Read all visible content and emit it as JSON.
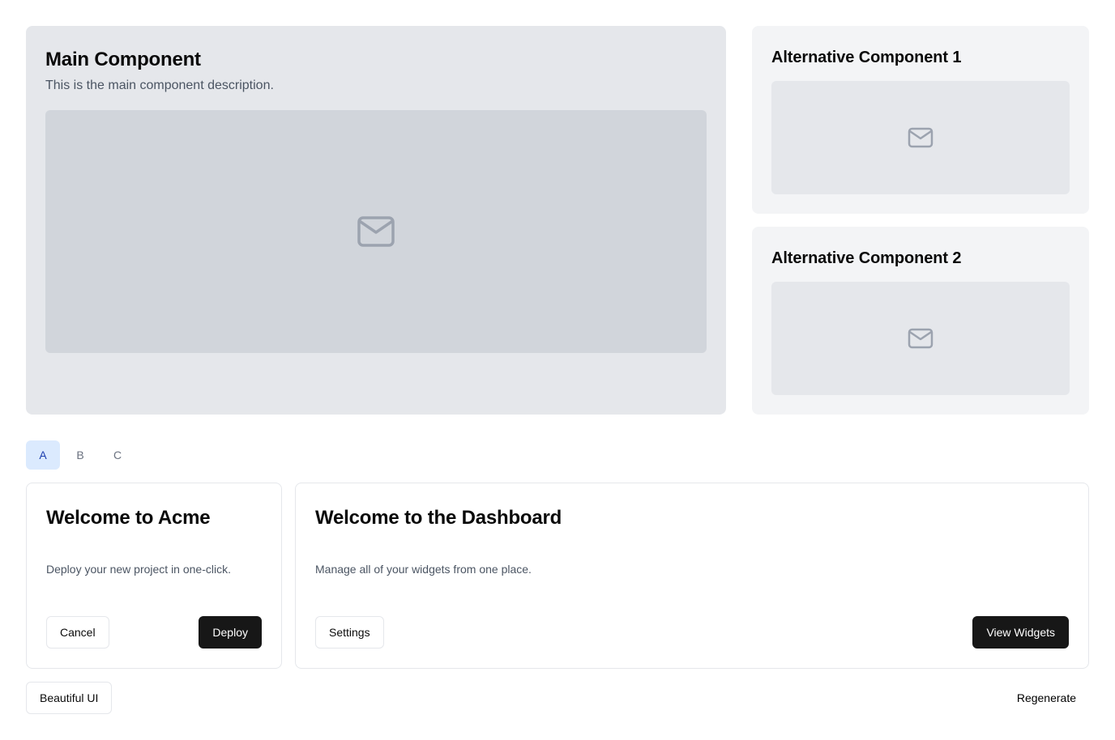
{
  "main": {
    "title": "Main Component",
    "description": "This is the main component description."
  },
  "alternatives": [
    {
      "title": "Alternative Component 1"
    },
    {
      "title": "Alternative Component 2"
    }
  ],
  "tabs": [
    {
      "label": "A",
      "active": true
    },
    {
      "label": "B",
      "active": false
    },
    {
      "label": "C",
      "active": false
    }
  ],
  "cards": {
    "acme": {
      "title": "Welcome to Acme",
      "description": "Deploy your new project in one-click.",
      "secondary_label": "Cancel",
      "primary_label": "Deploy"
    },
    "dashboard": {
      "title": "Welcome to the Dashboard",
      "description": "Manage all of your widgets from one place.",
      "secondary_label": "Settings",
      "primary_label": "View Widgets"
    }
  },
  "footer": {
    "left_label": "Beautiful UI",
    "right_label": "Regenerate"
  },
  "icons": {
    "placeholder": "mail-icon"
  },
  "colors": {
    "accent_tab_bg": "#dbeafe",
    "accent_tab_text": "#1e40af",
    "primary_button": "#171717",
    "placeholder_icon": "#9ca3af"
  }
}
